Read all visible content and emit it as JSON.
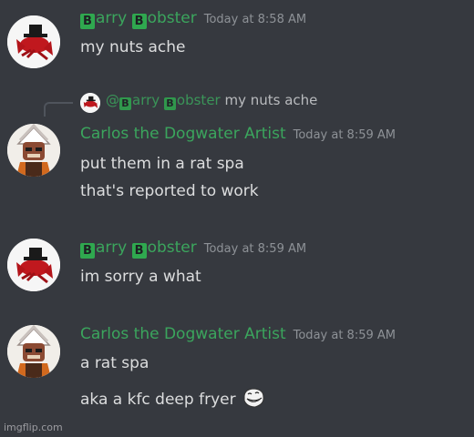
{
  "messages": [
    {
      "author": {
        "badge1": "B",
        "rest1": "arry ",
        "badge2": "B",
        "rest2": "obster"
      },
      "timestamp": "Today at 8:58 AM",
      "lines": [
        "my nuts ache"
      ]
    },
    {
      "reply": {
        "at": "@",
        "badge1": "B",
        "rest1": "arry ",
        "badge2": "B",
        "rest2": "obster",
        "snippet": "my nuts ache"
      },
      "author_name": "Carlos the Dogwater Artist",
      "timestamp": "Today at 8:59 AM",
      "lines": [
        "put them in a rat spa",
        "that's reported to work"
      ]
    },
    {
      "author": {
        "badge1": "B",
        "rest1": "arry ",
        "badge2": "B",
        "rest2": "obster"
      },
      "timestamp": "Today at 8:59 AM",
      "lines": [
        "im sorry a what"
      ]
    },
    {
      "author_name": "Carlos the Dogwater Artist",
      "timestamp": "Today at 8:59 AM",
      "lines": [
        "a rat spa",
        "aka a kfc deep fryer"
      ],
      "emoji": "trollface-icon"
    }
  ],
  "watermark": "imgflip.com",
  "colors": {
    "background": "#36393f",
    "name": "#3ba55d",
    "text": "#dcddde",
    "timestamp": "#8e9297"
  }
}
